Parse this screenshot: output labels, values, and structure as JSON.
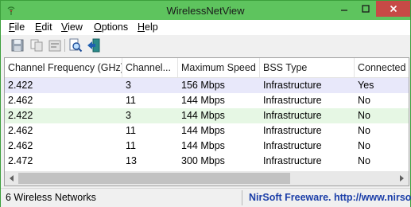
{
  "window": {
    "title": "WirelessNetView",
    "icon": "wifi-antenna-icon",
    "controls": {
      "minimize": "minimize-icon",
      "maximize": "maximize-icon",
      "close": "close-icon"
    },
    "close_color": "#c74a46",
    "titlebar_color": "#5ec45e"
  },
  "menu": [
    {
      "prefix": "",
      "underline": "F",
      "rest": "ile"
    },
    {
      "prefix": "",
      "underline": "E",
      "rest": "dit"
    },
    {
      "prefix": "",
      "underline": "V",
      "rest": "iew"
    },
    {
      "prefix": "",
      "underline": "O",
      "rest": "ptions"
    },
    {
      "prefix": "",
      "underline": "H",
      "rest": "elp"
    }
  ],
  "toolbar": {
    "icons": [
      "save-icon",
      "copy-icon",
      "properties-icon",
      "find-icon",
      "exit-icon"
    ]
  },
  "list": {
    "columns": [
      "Channel Frequency (GHz)",
      "Channel...",
      "Maximum Speed",
      "BSS Type",
      "Connected"
    ],
    "rows": [
      [
        "2.422",
        "3",
        "156 Mbps",
        "Infrastructure",
        "Yes"
      ],
      [
        "2.462",
        "11",
        "144 Mbps",
        "Infrastructure",
        "No"
      ],
      [
        "2.422",
        "3",
        "144 Mbps",
        "Infrastructure",
        "No"
      ],
      [
        "2.462",
        "11",
        "144 Mbps",
        "Infrastructure",
        "No"
      ],
      [
        "2.462",
        "11",
        "144 Mbps",
        "Infrastructure",
        "No"
      ],
      [
        "2.472",
        "13",
        "300 Mbps",
        "Infrastructure",
        "No"
      ]
    ],
    "selected_row": 0,
    "highlight_row": 2,
    "selected_color": "#e8e8fa",
    "highlight_color": "#e6f7e4"
  },
  "status": {
    "count_text": "6 Wireless Networks",
    "link_text": "NirSoft Freeware.  http://www.nirsof",
    "link_color": "#1b3ea8"
  }
}
